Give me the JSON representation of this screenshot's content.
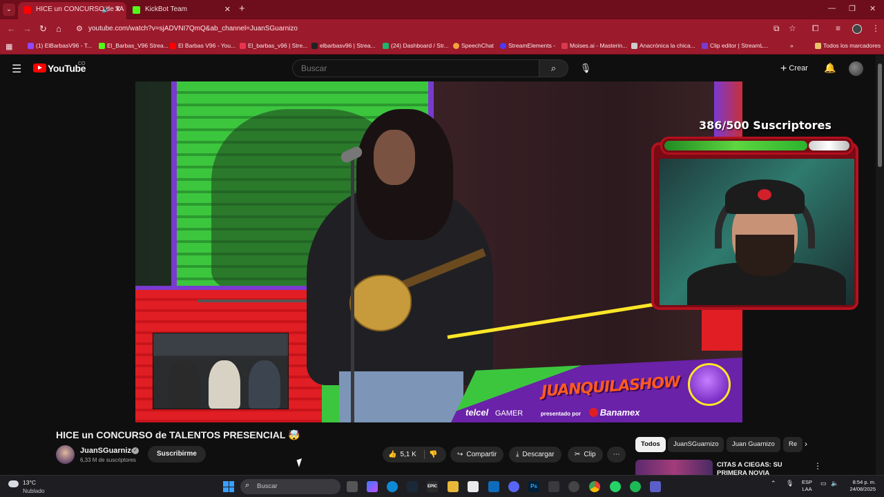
{
  "browser": {
    "tabs": [
      {
        "title": "HICE un CONCURSO de TA",
        "active": true
      },
      {
        "title": "KickBot Team",
        "active": false
      }
    ],
    "url": "youtube.com/watch?v=sjADVNI7QmQ&ab_channel=JuanSGuarnizo",
    "bookmarks": [
      {
        "label": "(1) ElBarbasV96 - T...",
        "color": "#9146ff"
      },
      {
        "label": "El_Barbas_V96 Strea...",
        "color": "#53fc18"
      },
      {
        "label": "El Barbas V96 - You...",
        "color": "#ff0000"
      },
      {
        "label": "El_barbas_v96 | Stre...",
        "color": "#e8344e"
      },
      {
        "label": "elbarbasv96 | Strea...",
        "color": "#222222"
      },
      {
        "label": "(24) Dashboard / Str...",
        "color": "#1fb36b"
      },
      {
        "label": "SpeechChat",
        "color": "#f2a33a"
      },
      {
        "label": "StreamElements -",
        "color": "#4b3bff"
      },
      {
        "label": "Moises.ai - Masterin...",
        "color": "#d93a4e"
      },
      {
        "label": "Anacrónica la chica...",
        "color": "#cccccc"
      },
      {
        "label": "Clip editor | StreamL...",
        "color": "#7a3bd0"
      }
    ],
    "all_bookmarks": "Todos los marcadores"
  },
  "youtube": {
    "logo_text": "YouTube",
    "country_code": "CO",
    "search_placeholder": "Buscar",
    "create_label": "Crear"
  },
  "overlay": {
    "sub_counter": "386/500 Suscriptores",
    "sub_progress": 0.772,
    "show_title": "JUANQUILASHOW",
    "sponsor_telcel": "telcel",
    "sponsor_gamer": "GAMER",
    "presented_by": "presentado por",
    "sponsor_bank": "Banamex"
  },
  "video": {
    "title": "HICE un CONCURSO de TALENTOS PRESENCIAL 🤯",
    "channel": "JuanSGuarnizo",
    "subscribers": "6,33 M de suscriptores",
    "subscribe_label": "Suscribirme",
    "likes": "5,1 K",
    "share_label": "Compartir",
    "download_label": "Descargar",
    "clip_label": "Clip"
  },
  "chips": [
    "Todos",
    "JuanSGuarnizo",
    "Juan Guarnizo",
    "Re"
  ],
  "recommendation": {
    "title": "CITAS A CIEGAS: SU PRIMERA NOVIA"
  },
  "taskbar": {
    "temperature": "13°C",
    "weather": "Nublado",
    "search_placeholder": "Buscar",
    "lang_top": "ESP",
    "lang_bottom": "LAA",
    "time": "8:54 p. m.",
    "date": "24/08/2025"
  }
}
